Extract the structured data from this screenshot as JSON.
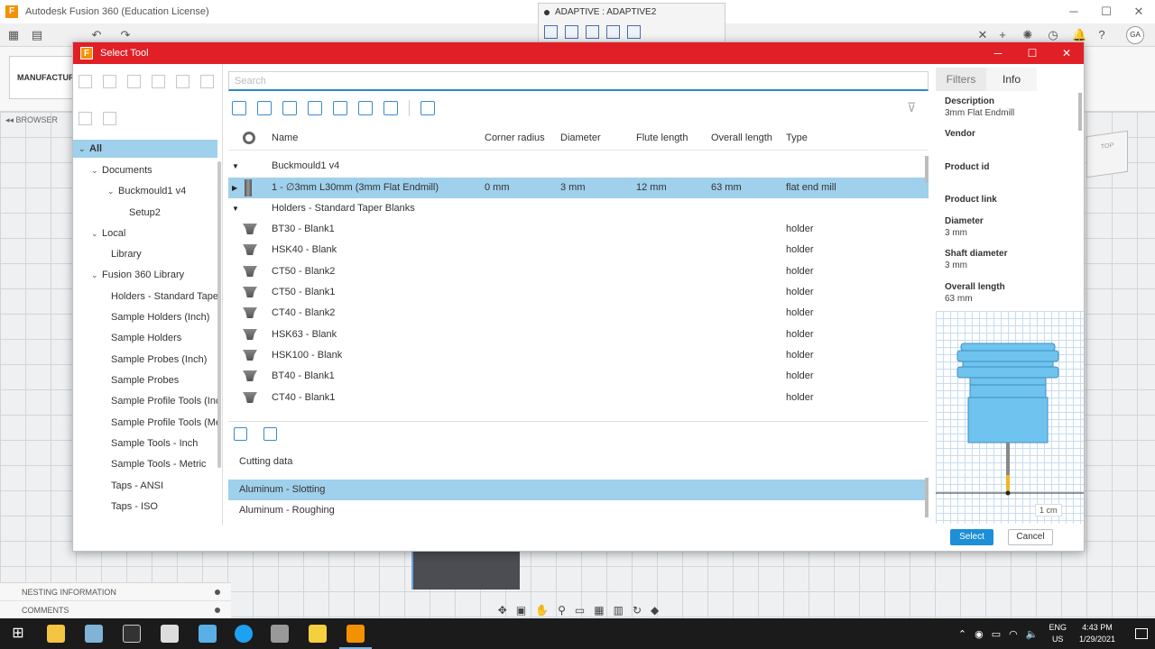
{
  "app": {
    "title": "Autodesk Fusion 360 (Education License)",
    "tab_title": "ADAPTIVE : ADAPTIVE2",
    "workspace": "MANUFACTUR",
    "browser_label": "BROWSER",
    "avatar": "GA",
    "bottom_panels": [
      "NESTING INFORMATION",
      "COMMENTS"
    ]
  },
  "dialog": {
    "title": "Select Tool",
    "search_placeholder": "Search",
    "select_button": "Select",
    "cancel_button": "Cancel"
  },
  "tree": {
    "items": [
      {
        "label": "All",
        "selected": true
      },
      {
        "label": "Documents"
      },
      {
        "label": "Buckmould1 v4"
      },
      {
        "label": "Setup2"
      },
      {
        "label": "Local"
      },
      {
        "label": "Library"
      },
      {
        "label": "Fusion 360 Library"
      },
      {
        "label": "Holders - Standard Taper"
      },
      {
        "label": "Sample Holders (Inch)"
      },
      {
        "label": "Sample Holders"
      },
      {
        "label": "Sample Probes (Inch)"
      },
      {
        "label": "Sample Probes"
      },
      {
        "label": "Sample Profile Tools (Inc"
      },
      {
        "label": "Sample Profile Tools (Me"
      },
      {
        "label": "Sample Tools - Inch"
      },
      {
        "label": "Sample Tools - Metric"
      },
      {
        "label": "Taps - ANSI"
      },
      {
        "label": "Taps - ISO"
      }
    ]
  },
  "table": {
    "columns": [
      "Name",
      "Corner radius",
      "Diameter",
      "Flute length",
      "Overall length",
      "Type"
    ],
    "group1": "Buckmould1 v4",
    "tool_row": {
      "name": "1 - ∅3mm L30mm (3mm Flat Endmill)",
      "corner_radius": "0 mm",
      "diameter": "3 mm",
      "flute_length": "12 mm",
      "overall_length": "63 mm",
      "type": "flat end mill"
    },
    "group2": "Holders - Standard Taper Blanks",
    "holders": [
      {
        "name": "BT30 - Blank1",
        "type": "holder"
      },
      {
        "name": "HSK40 - Blank",
        "type": "holder"
      },
      {
        "name": "CT50 - Blank2",
        "type": "holder"
      },
      {
        "name": "CT50 - Blank1",
        "type": "holder"
      },
      {
        "name": "CT40 - Blank2",
        "type": "holder"
      },
      {
        "name": "HSK63 - Blank",
        "type": "holder"
      },
      {
        "name": "HSK100 - Blank",
        "type": "holder"
      },
      {
        "name": "BT40 - Blank1",
        "type": "holder"
      },
      {
        "name": "CT40 - Blank1",
        "type": "holder"
      }
    ]
  },
  "cutting": {
    "title": "Cutting data",
    "rows": [
      "Aluminum - Slotting",
      "Aluminum - Roughing"
    ]
  },
  "info": {
    "tabs": [
      "Filters",
      "Info"
    ],
    "fields": [
      {
        "label": "Description",
        "value": "3mm Flat Endmill"
      },
      {
        "label": "Vendor",
        "value": ""
      },
      {
        "label": "Product id",
        "value": ""
      },
      {
        "label": "Product link",
        "value": ""
      },
      {
        "label": "Diameter",
        "value": "3 mm"
      },
      {
        "label": "Shaft diameter",
        "value": "3 mm"
      },
      {
        "label": "Overall length",
        "value": "63 mm"
      }
    ],
    "scale": "1 cm"
  },
  "taskbar": {
    "lang1": "ENG",
    "lang2": "US",
    "time": "4:43 PM",
    "date": "1/29/2021"
  },
  "colors": {
    "dialog_title": "#e11f26",
    "selection": "#9fd0ec",
    "accent": "#1c8fd6",
    "tool_preview": "#6ec3ef"
  }
}
